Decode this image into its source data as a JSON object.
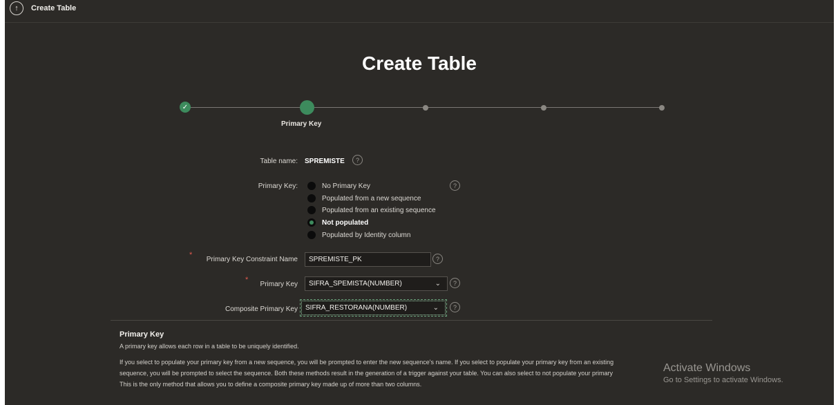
{
  "topbar": {
    "back_icon": "arrow-up-circle-icon",
    "title": "Create Table"
  },
  "page_title": "Create Table",
  "wizard": {
    "current_step_label": "Primary Key",
    "steps_total": 5,
    "completed_steps": 1,
    "current_step": 2
  },
  "form": {
    "table_name_label": "Table name:",
    "table_name_value": "SPREMISTE",
    "primary_key_label": "Primary Key:",
    "primary_key_options": [
      {
        "label": "No Primary Key",
        "selected": false
      },
      {
        "label": "Populated from a new sequence",
        "selected": false
      },
      {
        "label": "Populated from an existing sequence",
        "selected": false
      },
      {
        "label": "Not populated",
        "selected": true
      },
      {
        "label": "Populated by Identity column",
        "selected": false
      }
    ],
    "constraint_name_label": "Primary Key Constraint Name",
    "constraint_name_value": "SPREMISTE_PK",
    "pk_column_label": "Primary Key",
    "pk_column_value": "SIFRA_SPEMISTA(NUMBER)",
    "composite_pk_label": "Composite Primary Key",
    "composite_pk_value": "SIFRA_RESTORANA(NUMBER)",
    "help_icon_glyph": "?",
    "required_marker": "*"
  },
  "help_panel": {
    "title": "Primary Key",
    "line1": "A primary key allows each row in a table to be uniquely identified.",
    "line2": "If you select to populate your primary key from a new sequence, you will be prompted to enter the new sequence's name. If you select to populate your primary key from an existing",
    "line3": "sequence, you will be prompted to select the sequence. Both these methods result in the generation of a trigger against your table. You can also select to not populate your primary",
    "line4": "This is the only method that allows you to define a composite primary key made up of more than two columns."
  },
  "watermark": {
    "line1": "Activate Windows",
    "line2": "Go to Settings to activate Windows."
  },
  "colors": {
    "background": "#2c2a27",
    "accent_green": "#3d8b5d",
    "required_red": "#e05a4f"
  }
}
